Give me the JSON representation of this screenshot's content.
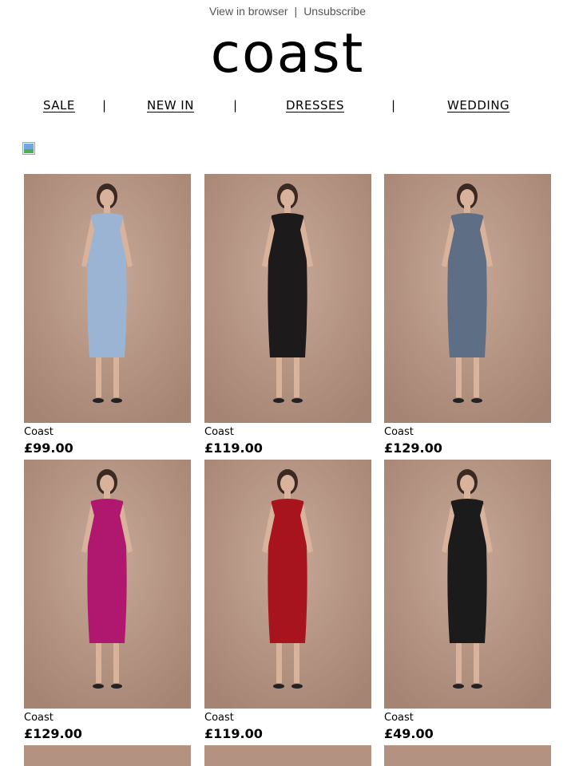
{
  "header": {
    "view_in_browser": "View in browser",
    "separator": "|",
    "unsubscribe": "Unsubscribe"
  },
  "logo": "coast",
  "nav": {
    "items": [
      {
        "label": "SALE"
      },
      {
        "label": "NEW IN"
      },
      {
        "label": "DRESSES"
      },
      {
        "label": "WEDDING"
      }
    ],
    "divider": "|"
  },
  "products": [
    {
      "brand": "Coast",
      "price": "£99.00",
      "dress_color": "#9cb4d4"
    },
    {
      "brand": "Coast",
      "price": "£119.00",
      "dress_color": "#1c1a1a"
    },
    {
      "brand": "Coast",
      "price": "£129.00",
      "dress_color": "#5e6e85"
    },
    {
      "brand": "Coast",
      "price": "£129.00",
      "dress_color": "#b0176e"
    },
    {
      "brand": "Coast",
      "price": "£119.00",
      "dress_color": "#a8141e"
    },
    {
      "brand": "Coast",
      "price": "£49.00",
      "dress_color": "#1b1b1b"
    }
  ],
  "colors": {
    "photo_background": "#b49281",
    "text": "#000000",
    "muted_text": "#555555"
  }
}
